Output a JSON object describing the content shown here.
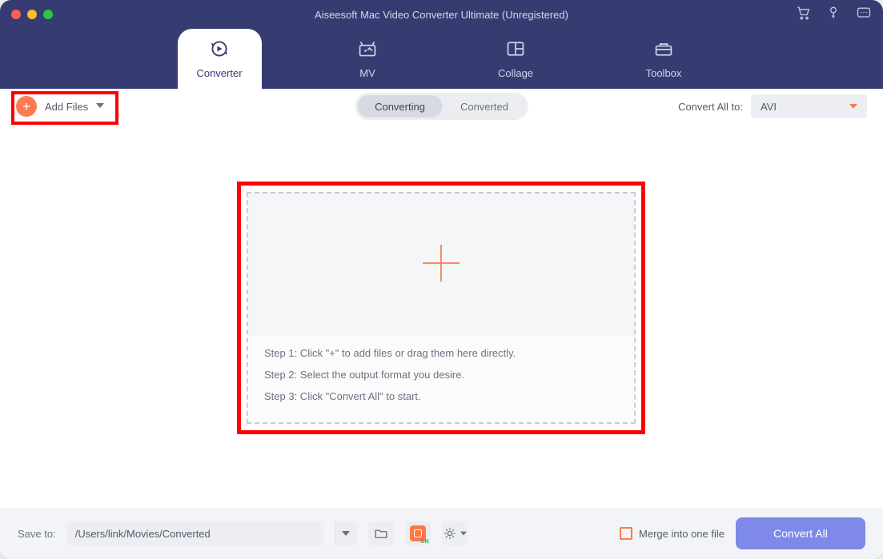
{
  "title": "Aiseesoft Mac Video Converter Ultimate (Unregistered)",
  "nav": {
    "converter": "Converter",
    "mv": "MV",
    "collage": "Collage",
    "toolbox": "Toolbox"
  },
  "toolbar": {
    "add_files": "Add Files",
    "converting_tab": "Converting",
    "converted_tab": "Converted",
    "convert_all_to_label": "Convert All to:",
    "format_selected": "AVI"
  },
  "dropzone": {
    "step1": "Step 1: Click \"+\" to add files or drag them here directly.",
    "step2": "Step 2: Select the output format you desire.",
    "step3": "Step 3: Click \"Convert All\" to start."
  },
  "bottom": {
    "save_to_label": "Save to:",
    "save_path": "/Users/link/Movies/Converted",
    "merge_label": "Merge into one file",
    "convert_all_button": "Convert All"
  }
}
